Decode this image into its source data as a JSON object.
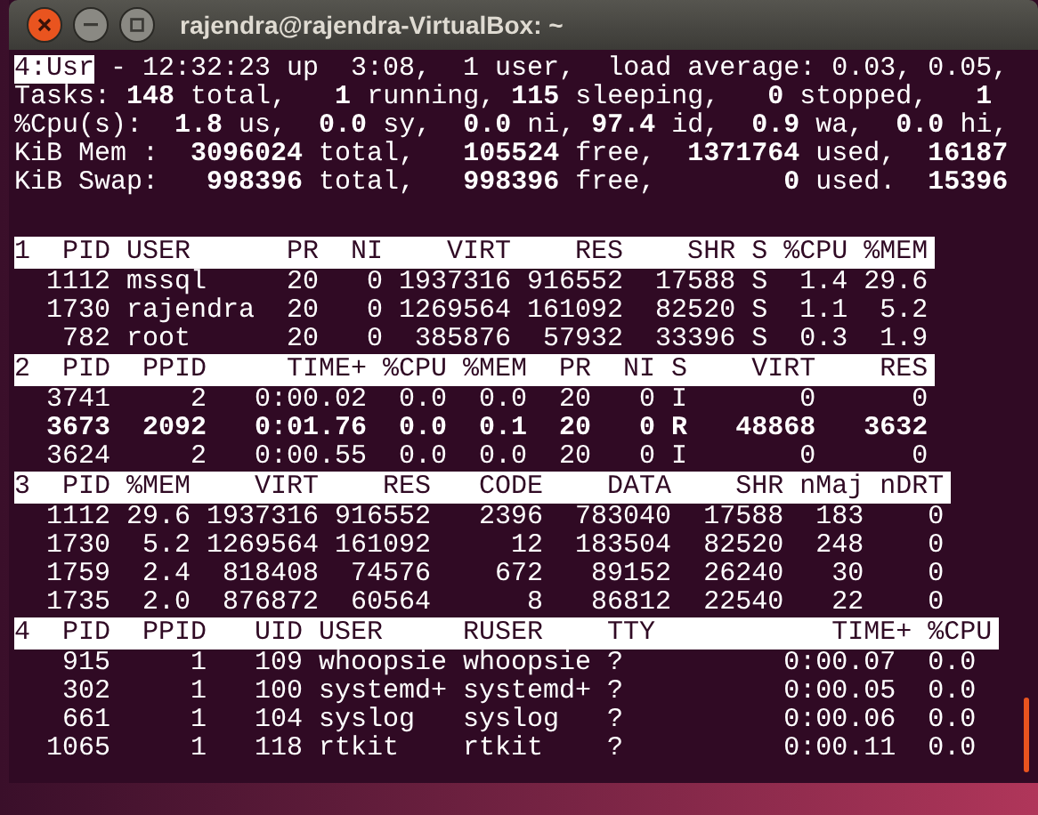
{
  "window": {
    "title": "rajendra@rajendra-VirtualBox: ~"
  },
  "current_window": "4:Usr",
  "uptime_line": " - 12:32:23 up  3:08,  1 user,  load average: 0.03, 0.05,",
  "summary_lines": [
    "Tasks: **148** total,   **1** running, **115** sleeping,   **0** stopped,   **1**",
    "%Cpu(s):  **1.8** us,  **0.0** sy,  **0.0** ni, **97.4** id,  **0.9** wa,  **0.0** hi,",
    "KiB Mem :  **3096024** total,   **105524** free,  **1371764** used,  **16187**",
    "KiB Swap:   **998396** total,   **998396** free,        **0** used.  **15396**"
  ],
  "field_windows": [
    {
      "header": "1  PID USER      PR  NI    VIRT    RES    SHR S %CPU %MEM",
      "rows": [
        {
          "text": "  1112 mssql     20   0 1937316 916552  17588 S  1.4 29.6",
          "bold": false
        },
        {
          "text": "  1730 rajendra  20   0 1269564 161092  82520 S  1.1  5.2",
          "bold": false
        },
        {
          "text": "   782 root      20   0  385876  57932  33396 S  0.3  1.9",
          "bold": false
        }
      ]
    },
    {
      "header": "2  PID  PPID     TIME+ %CPU %MEM  PR  NI S    VIRT    RES",
      "rows": [
        {
          "text": "  3741     2   0:00.02  0.0  0.0  20   0 I       0      0",
          "bold": false
        },
        {
          "text": "  3673  2092   0:01.76  0.0  0.1  20   0 R   48868   3632",
          "bold": true
        },
        {
          "text": "  3624     2   0:00.55  0.0  0.0  20   0 I       0      0",
          "bold": false
        }
      ]
    },
    {
      "header": "3  PID %MEM    VIRT    RES   CODE    DATA    SHR nMaj nDRT",
      "rows": [
        {
          "text": "  1112 29.6 1937316 916552   2396  783040  17588  183    0",
          "bold": false
        },
        {
          "text": "  1730  5.2 1269564 161092     12  183504  82520  248    0",
          "bold": false
        },
        {
          "text": "  1759  2.4  818408  74576    672   89152  26240   30    0",
          "bold": false
        },
        {
          "text": "  1735  2.0  876872  60564      8   86812  22540   22    0",
          "bold": false
        }
      ]
    },
    {
      "header": "4  PID  PPID   UID USER     RUSER    TTY           TIME+ %CPU",
      "rows": [
        {
          "text": "   915     1   109 whoopsie whoopsie ?          0:00.07  0.0",
          "bold": false
        },
        {
          "text": "   302     1   100 systemd+ systemd+ ?          0:00.05  0.0",
          "bold": false
        },
        {
          "text": "   661     1   104 syslog   syslog   ?          0:00.06  0.0",
          "bold": false
        },
        {
          "text": "  1065     1   118 rtkit    rtkit    ?          0:00.11  0.0",
          "bold": false
        }
      ]
    }
  ]
}
